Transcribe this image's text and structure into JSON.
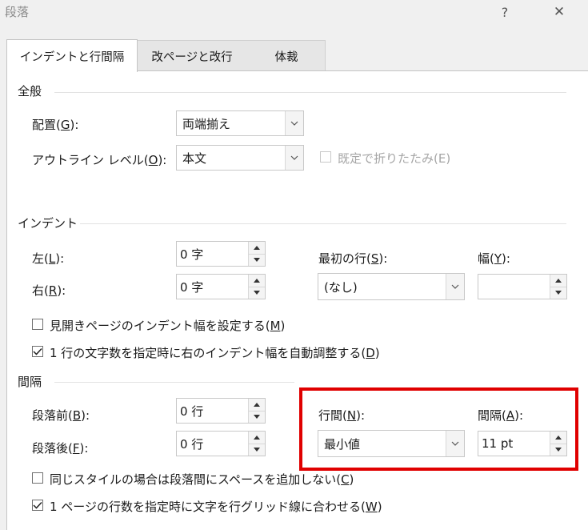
{
  "window": {
    "title": "段落",
    "help_label": "?",
    "close_label": "✕"
  },
  "tabs": [
    {
      "label": "インデントと行間隔",
      "active": true
    },
    {
      "label": "改ページと改行",
      "active": false
    },
    {
      "label": "体裁",
      "active": false
    }
  ],
  "general": {
    "heading": "全般",
    "alignment": {
      "label": "配置",
      "key": "G",
      "value": "両端揃え"
    },
    "outline": {
      "label": "アウトライン レベル",
      "key": "O",
      "value": "本文"
    },
    "collapse": {
      "label": "既定で折りたたみ(E)",
      "checked": false,
      "disabled": true
    }
  },
  "indent": {
    "heading": "インデント",
    "left": {
      "label": "左",
      "key": "L",
      "value": "0 字"
    },
    "right": {
      "label": "右",
      "key": "R",
      "value": "0 字"
    },
    "first_line": {
      "label": "最初の行",
      "key": "S",
      "value": "(なし)"
    },
    "by": {
      "label": "幅",
      "key": "Y",
      "value": ""
    },
    "mirror": {
      "label_pre": "見開きページのインデント幅を設定する",
      "key": "M",
      "checked": false
    },
    "auto_adjust": {
      "label_pre": "1 行の文字数を指定時に右のインデント幅を自動調整する",
      "key": "D",
      "checked": true
    }
  },
  "spacing": {
    "heading": "間隔",
    "before": {
      "label": "段落前",
      "key": "B",
      "value": "0 行"
    },
    "after": {
      "label": "段落後",
      "key": "F",
      "value": "0 行"
    },
    "line_spacing": {
      "label": "行間",
      "key": "N",
      "value": "最小値"
    },
    "at": {
      "label": "間隔",
      "key": "A",
      "value": "11 pt"
    },
    "no_space_same_style": {
      "label_pre": "同じスタイルの場合は段落間にスペースを追加しない",
      "key": "C",
      "checked": false
    },
    "snap_to_grid": {
      "label_pre": "1 ページの行数を指定時に文字を行グリッド線に合わせる",
      "key": "W",
      "checked": true
    }
  },
  "highlight_color": "#e00000"
}
